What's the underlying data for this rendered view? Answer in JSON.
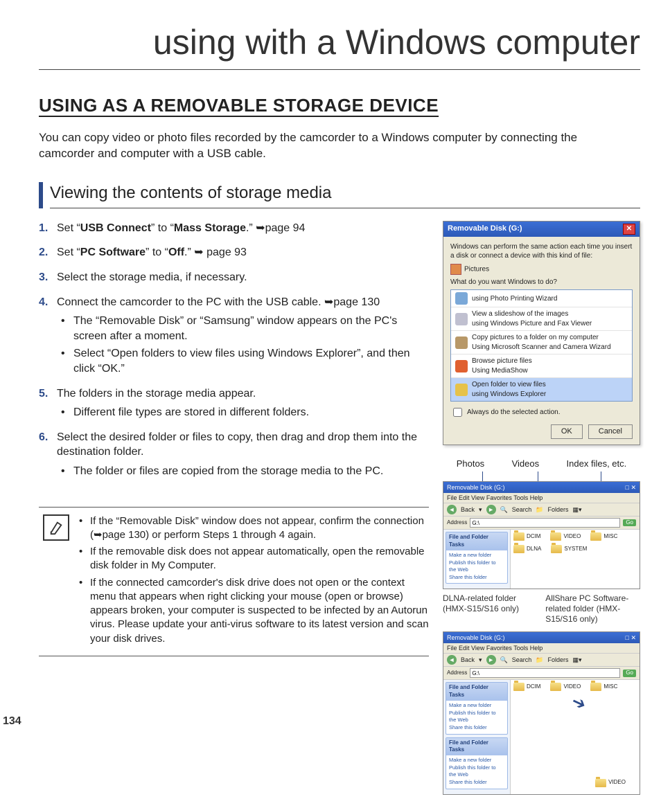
{
  "page_number": "134",
  "page_title": "using with a Windows computer",
  "section_heading": "USING AS A REMOVABLE STORAGE DEVICE",
  "intro": "You can copy video or photo files recorded by the camcorder to a Windows computer by connecting the camcorder and computer with a USB cable.",
  "sub_heading": "Viewing the contents of storage media",
  "steps": [
    {
      "pre": "Set “",
      "b1": "USB Connect",
      "mid": "” to “",
      "b2": "Mass Storage",
      "post": ".” ➥page 94"
    },
    {
      "pre": "Set “",
      "b1": "PC Software",
      "mid": "” to “",
      "b2": "Off",
      "post": ".” ➥ page 93"
    },
    {
      "text": "Select the storage media, if necessary."
    },
    {
      "text": "Connect the camcorder to the PC with the USB cable. ➥page 130",
      "subs": [
        "The “Removable Disk” or “Samsung” window appears on the PC's screen after a moment.",
        "Select “Open folders to view files using Windows Explorer”, and then click “OK.”"
      ]
    },
    {
      "text": "The folders in the storage media appear.",
      "subs": [
        "Different file types are stored in different folders."
      ]
    },
    {
      "text": "Select the desired folder or files to copy, then drag and drop them into the destination folder.",
      "subs": [
        "The folder or files are copied from the storage media to the PC."
      ]
    }
  ],
  "notes": [
    "If the “Removable Disk” window does not appear, confirm the connection (➥page 130) or perform Steps 1 through 4 again.",
    "If the removable disk does not appear automatically, open the removable disk folder in My Computer.",
    "If the connected camcorder's disk drive does not open or the context menu that appears when right clicking your mouse (open or browse) appears broken, your computer is suspected to be infected by an Autorun virus. Please update your anti-virus software to its latest version and scan your disk drives."
  ],
  "dialog": {
    "title": "Removable Disk (G:)",
    "msg1": "Windows can perform the same action each time you insert a disk or connect a device with this kind of file:",
    "filetype": "Pictures",
    "msg2": "What do you want Windows to do?",
    "options": [
      {
        "t1": "using Photo Printing Wizard",
        "t2": "",
        "color": "#7aa8d8"
      },
      {
        "t1": "View a slideshow of the images",
        "t2": "using Windows Picture and Fax Viewer",
        "color": "#c0c0d0"
      },
      {
        "t1": "Copy pictures to a folder on my computer",
        "t2": "Using Microsoft Scanner and Camera Wizard",
        "color": "#b89868"
      },
      {
        "t1": "Browse picture files",
        "t2": "Using MediaShow",
        "color": "#e06030"
      },
      {
        "t1": "Open folder to view files",
        "t2": "using Windows Explorer",
        "color": "#e6c24a",
        "selected": true
      }
    ],
    "checkbox": "Always do the selected action.",
    "ok": "OK",
    "cancel": "Cancel"
  },
  "callouts": {
    "photos": "Photos",
    "videos": "Videos",
    "index": "Index files, etc."
  },
  "explorer": {
    "title": "Removable Disk (G:)",
    "menu": "File   Edit   View   Favorites   Tools   Help",
    "back": "Back",
    "search": "Search",
    "folders": "Folders",
    "address_label": "Address",
    "address_value": "G:\\",
    "go": "Go",
    "task_head": "File and Folder Tasks",
    "tasks": [
      "Make a new folder",
      "Publish this folder to the Web",
      "Share this folder"
    ],
    "folders_top": [
      "DCIM",
      "VIDEO",
      "MISC"
    ],
    "folders_bot": [
      "DLNA",
      "SYSTEM"
    ],
    "folders2_top": [
      "DCIM",
      "VIDEO",
      "MISC"
    ],
    "folders2_sub": [
      "VIDEO"
    ]
  },
  "annot": {
    "dlna": "DLNA-related folder (HMX-S15/S16 only)",
    "allshare": "AllShare PC Software-related folder (HMX-S15/S16 only)"
  }
}
